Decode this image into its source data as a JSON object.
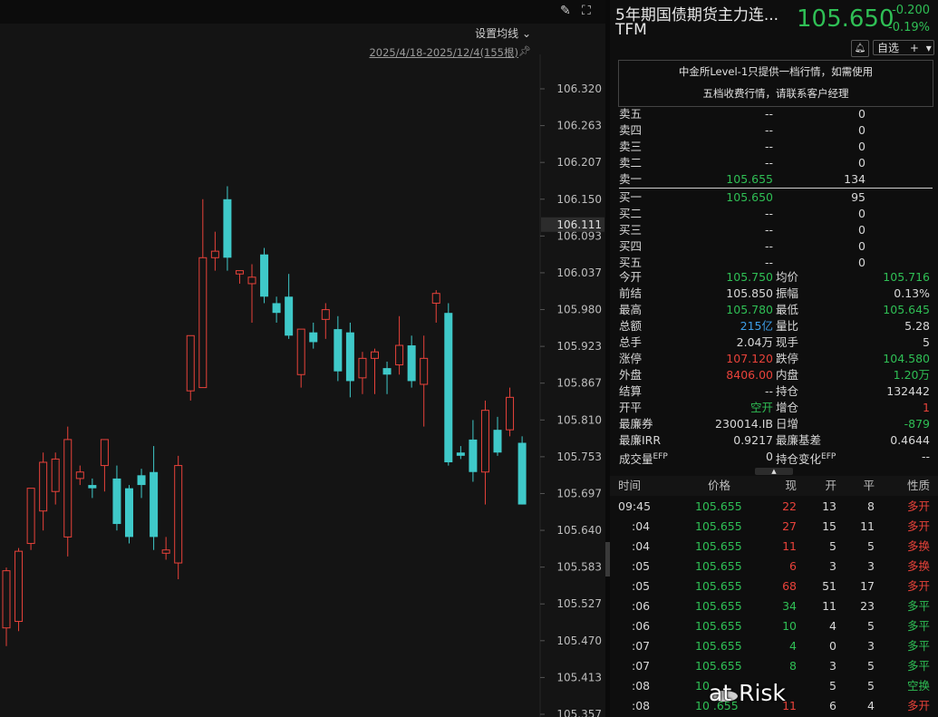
{
  "colors": {
    "up": "#e8423a",
    "down": "#3fc9c9",
    "green": "#2fbf55",
    "axis_bg": "#141414"
  },
  "toolbar": {
    "draw_icon": "pen-icon",
    "fullscreen_icon": "fullscreen-icon",
    "ma_setting": "设置均线",
    "range": "2025/4/18-2025/12/4(155根)",
    "pin_icon": "pin-icon"
  },
  "chart_data": {
    "type": "candlestick",
    "y_ticks": [
      "106.320",
      "106.263",
      "106.207",
      "106.150",
      "106.093",
      "106.037",
      "105.980",
      "105.923",
      "105.867",
      "105.810",
      "105.753",
      "105.697",
      "105.640",
      "105.583",
      "105.527",
      "105.470",
      "105.413",
      "105.357"
    ],
    "current_price_label": "106.111",
    "ylim": [
      105.357,
      106.32
    ],
    "candles": [
      {
        "o": 105.49,
        "h": 105.583,
        "l": 105.462,
        "c": 105.578
      },
      {
        "o": 105.5,
        "h": 105.613,
        "l": 105.485,
        "c": 105.608
      },
      {
        "o": 105.62,
        "h": 105.7,
        "l": 105.61,
        "c": 105.705
      },
      {
        "o": 105.67,
        "h": 105.76,
        "l": 105.64,
        "c": 105.745
      },
      {
        "o": 105.7,
        "h": 105.76,
        "l": 105.68,
        "c": 105.75
      },
      {
        "o": 105.63,
        "h": 105.8,
        "l": 105.6,
        "c": 105.78
      },
      {
        "o": 105.72,
        "h": 105.74,
        "l": 105.71,
        "c": 105.73
      },
      {
        "o": 105.71,
        "h": 105.72,
        "l": 105.69,
        "c": 105.705
      },
      {
        "o": 105.74,
        "h": 105.78,
        "l": 105.7,
        "c": 105.78
      },
      {
        "o": 105.72,
        "h": 105.74,
        "l": 105.64,
        "c": 105.65
      },
      {
        "o": 105.705,
        "h": 105.71,
        "l": 105.62,
        "c": 105.63
      },
      {
        "o": 105.725,
        "h": 105.735,
        "l": 105.69,
        "c": 105.71
      },
      {
        "o": 105.73,
        "h": 105.77,
        "l": 105.61,
        "c": 105.63
      },
      {
        "o": 105.605,
        "h": 105.63,
        "l": 105.595,
        "c": 105.61
      },
      {
        "o": 105.59,
        "h": 105.755,
        "l": 105.565,
        "c": 105.74
      },
      {
        "o": 105.855,
        "h": 105.935,
        "l": 105.84,
        "c": 105.94
      },
      {
        "o": 105.86,
        "h": 106.15,
        "l": 105.86,
        "c": 106.06
      },
      {
        "o": 106.06,
        "h": 106.1,
        "l": 106.04,
        "c": 106.07
      },
      {
        "o": 106.15,
        "h": 106.17,
        "l": 106.04,
        "c": 106.06
      },
      {
        "o": 106.035,
        "h": 106.04,
        "l": 106.02,
        "c": 106.04
      },
      {
        "o": 106.02,
        "h": 106.05,
        "l": 105.96,
        "c": 106.03
      },
      {
        "o": 106.065,
        "h": 106.075,
        "l": 105.99,
        "c": 106.0
      },
      {
        "o": 105.99,
        "h": 106.0,
        "l": 105.96,
        "c": 105.975
      },
      {
        "o": 106.0,
        "h": 106.035,
        "l": 105.935,
        "c": 105.94
      },
      {
        "o": 105.88,
        "h": 105.95,
        "l": 105.86,
        "c": 105.95
      },
      {
        "o": 105.945,
        "h": 105.96,
        "l": 105.92,
        "c": 105.93
      },
      {
        "o": 105.965,
        "h": 105.99,
        "l": 105.935,
        "c": 105.98
      },
      {
        "o": 105.95,
        "h": 105.97,
        "l": 105.87,
        "c": 105.885
      },
      {
        "o": 105.945,
        "h": 105.96,
        "l": 105.845,
        "c": 105.87
      },
      {
        "o": 105.875,
        "h": 105.915,
        "l": 105.85,
        "c": 105.905
      },
      {
        "o": 105.905,
        "h": 105.92,
        "l": 105.85,
        "c": 105.915
      },
      {
        "o": 105.89,
        "h": 105.9,
        "l": 105.85,
        "c": 105.88
      },
      {
        "o": 105.895,
        "h": 105.97,
        "l": 105.88,
        "c": 105.925
      },
      {
        "o": 105.925,
        "h": 105.94,
        "l": 105.86,
        "c": 105.87
      },
      {
        "o": 105.865,
        "h": 105.94,
        "l": 105.8,
        "c": 105.905
      },
      {
        "o": 105.99,
        "h": 106.01,
        "l": 105.96,
        "c": 106.005
      },
      {
        "o": 105.975,
        "h": 105.99,
        "l": 105.74,
        "c": 105.745
      },
      {
        "o": 105.76,
        "h": 105.77,
        "l": 105.75,
        "c": 105.755
      },
      {
        "o": 105.78,
        "h": 105.81,
        "l": 105.715,
        "c": 105.73
      },
      {
        "o": 105.73,
        "h": 105.84,
        "l": 105.68,
        "c": 105.825
      },
      {
        "o": 105.795,
        "h": 105.815,
        "l": 105.755,
        "c": 105.76
      },
      {
        "o": 105.795,
        "h": 105.86,
        "l": 105.785,
        "c": 105.845
      },
      {
        "o": 105.775,
        "h": 105.785,
        "l": 105.68,
        "c": 105.68
      }
    ]
  },
  "quote": {
    "name": "5年期国债期货主力连...",
    "code": "TFM",
    "price": "105.650",
    "change": "-0.200",
    "change_pct": "-0.19%",
    "bell_icon": "bell-icon",
    "watch_label": "自选",
    "watch_plus": "+",
    "watch_arrow": "▾",
    "notice_line1": "中金所Level-1只提供一档行情，如需使用",
    "notice_line2": "五档收费行情，请联系客户经理"
  },
  "orderbook": [
    {
      "label": "卖五",
      "price": "--",
      "vol": "0"
    },
    {
      "label": "卖四",
      "price": "--",
      "vol": "0"
    },
    {
      "label": "卖三",
      "price": "--",
      "vol": "0"
    },
    {
      "label": "卖二",
      "price": "--",
      "vol": "0"
    },
    {
      "label": "卖一",
      "price": "105.655",
      "vol": "134"
    },
    {
      "label": "买一",
      "price": "105.650",
      "vol": "95"
    },
    {
      "label": "买二",
      "price": "--",
      "vol": "0"
    },
    {
      "label": "买三",
      "price": "--",
      "vol": "0"
    },
    {
      "label": "买四",
      "price": "--",
      "vol": "0"
    },
    {
      "label": "买五",
      "price": "--",
      "vol": "0"
    }
  ],
  "stats": [
    {
      "l1": "今开",
      "v1": "105.750",
      "c1": "dn",
      "l2": "均价",
      "v2": "105.716",
      "c2": "dn"
    },
    {
      "l1": "前结",
      "v1": "105.850",
      "c1": "",
      "l2": "振幅",
      "v2": "0.13%",
      "c2": ""
    },
    {
      "l1": "最高",
      "v1": "105.780",
      "c1": "dn",
      "l2": "最低",
      "v2": "105.645",
      "c2": "dn"
    },
    {
      "l1": "总额",
      "v1": "215亿",
      "c1": "bl",
      "l2": "量比",
      "v2": "5.28",
      "c2": ""
    },
    {
      "l1": "总手",
      "v1": "2.04万",
      "c1": "",
      "l2": "现手",
      "v2": "5",
      "c2": ""
    },
    {
      "l1": "涨停",
      "v1": "107.120",
      "c1": "up",
      "l2": "跌停",
      "v2": "104.580",
      "c2": "dn"
    },
    {
      "l1": "外盘",
      "v1": "8406.00",
      "c1": "up",
      "l2": "内盘",
      "v2": "1.20万",
      "c2": "dn"
    },
    {
      "l1": "结算",
      "v1": "--",
      "c1": "",
      "l2": "持仓",
      "v2": "132442",
      "c2": ""
    },
    {
      "l1": "开平",
      "v1": "空开",
      "c1": "dn",
      "l2": "增仓",
      "v2": "1",
      "c2": "up"
    },
    {
      "l1": "最廉券",
      "v1": "230014.IB",
      "c1": "",
      "l2": "日增",
      "v2": "-879",
      "c2": "dn"
    },
    {
      "l1": "最廉IRR",
      "v1": "0.9217",
      "c1": "",
      "l2": "最廉基差",
      "v2": "0.4644",
      "c2": ""
    },
    {
      "l1": "成交量",
      "l1sup": "EFP",
      "v1": "0",
      "c1": "",
      "l2": "持仓变化",
      "l2sup": "EFP",
      "v2": "--",
      "c2": ""
    }
  ],
  "expand_icon": "▲",
  "ticks": {
    "headers": {
      "time": "时间",
      "price": "价格",
      "now": "现",
      "open": "开",
      "close": "平",
      "nature": "性质"
    },
    "rows": [
      {
        "time": "09:45",
        "price": "105.655",
        "now": "22",
        "open": "13",
        "close": "8",
        "nature": "多开",
        "nc": "up",
        "vc": "up"
      },
      {
        "time": ":04",
        "price": "105.655",
        "now": "27",
        "open": "15",
        "close": "11",
        "nature": "多开",
        "nc": "up",
        "vc": "up"
      },
      {
        "time": ":04",
        "price": "105.655",
        "now": "11",
        "open": "5",
        "close": "5",
        "nature": "多换",
        "nc": "up",
        "vc": "up"
      },
      {
        "time": ":05",
        "price": "105.655",
        "now": "6",
        "open": "3",
        "close": "3",
        "nature": "多换",
        "nc": "up",
        "vc": "up"
      },
      {
        "time": ":05",
        "price": "105.655",
        "now": "68",
        "open": "51",
        "close": "17",
        "nature": "多开",
        "nc": "up",
        "vc": "up"
      },
      {
        "time": ":06",
        "price": "105.655",
        "now": "34",
        "open": "11",
        "close": "23",
        "nature": "多平",
        "nc": "dn",
        "vc": "dn"
      },
      {
        "time": ":06",
        "price": "105.655",
        "now": "10",
        "open": "4",
        "close": "5",
        "nature": "多平",
        "nc": "dn",
        "vc": "dn"
      },
      {
        "time": ":07",
        "price": "105.655",
        "now": "4",
        "open": "0",
        "close": "3",
        "nature": "多平",
        "nc": "dn",
        "vc": "dn"
      },
      {
        "time": ":07",
        "price": "105.655",
        "now": "8",
        "open": "3",
        "close": "5",
        "nature": "多平",
        "nc": "dn",
        "vc": "dn"
      },
      {
        "time": ":08",
        "price": "10",
        "now": "",
        "open": "5",
        "close": "5",
        "nature": "空换",
        "nc": "dn",
        "vc": "dn"
      },
      {
        "time": ":08",
        "price": "10 .655",
        "now": "11",
        "open": "6",
        "close": "4",
        "nature": "多开",
        "nc": "up",
        "vc": "up"
      }
    ]
  },
  "watermark": {
    "text": "at  Risk"
  }
}
